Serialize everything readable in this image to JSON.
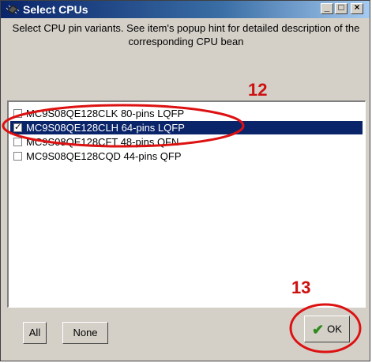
{
  "window": {
    "title": "Select CPUs",
    "min_symbol": "_",
    "max_symbol": "□",
    "close_symbol": "×"
  },
  "description": "Select CPU pin variants. See item's popup hint for detailed description of the corresponding CPU bean",
  "annotations": {
    "step_12": "12",
    "step_13": "13",
    "color": "#cc1111"
  },
  "list": {
    "items": [
      {
        "label": "MC9S08QE128CLK 80-pins LQFP",
        "checked": false,
        "selected": false
      },
      {
        "label": "MC9S08QE128CLH 64-pins LQFP",
        "checked": true,
        "selected": true
      },
      {
        "label": "MC9S08QE128CFT 48-pins QFN",
        "checked": false,
        "selected": false
      },
      {
        "label": "MC9S08QE128CQD 44-pins QFP",
        "checked": false,
        "selected": false
      }
    ]
  },
  "buttons": {
    "all": "All",
    "none": "None",
    "ok": "OK"
  },
  "icons": {
    "window_icon": "chip-icon",
    "ok_icon": "checkmark-icon"
  }
}
